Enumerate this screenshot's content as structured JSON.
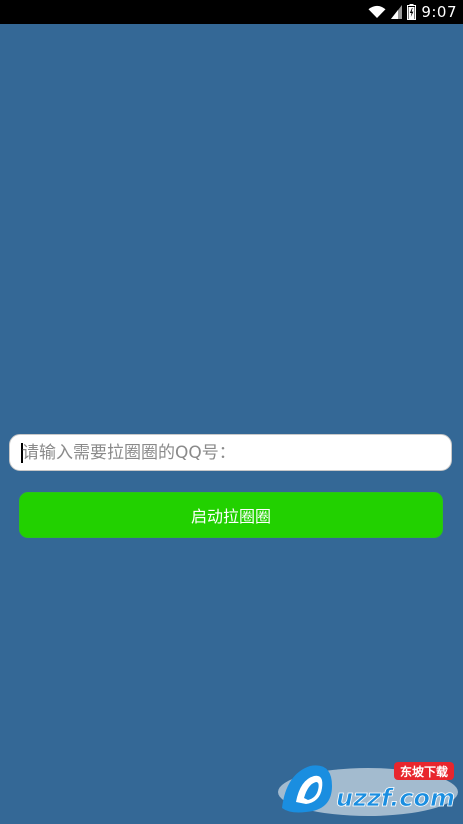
{
  "status_bar": {
    "time": "9:07",
    "icons": [
      "wifi-icon",
      "cell-signal-icon",
      "battery-icon"
    ]
  },
  "form": {
    "qq_input": {
      "value": "",
      "placeholder": "请输入需要拉圈圈的QQ号："
    },
    "start_button_label": "启动拉圈圈"
  },
  "watermark": {
    "text_main": "uzzf.com",
    "text_badge": "东坡下载"
  },
  "colors": {
    "background": "#346896",
    "button": "#22D100",
    "status_bar": "#000000"
  }
}
